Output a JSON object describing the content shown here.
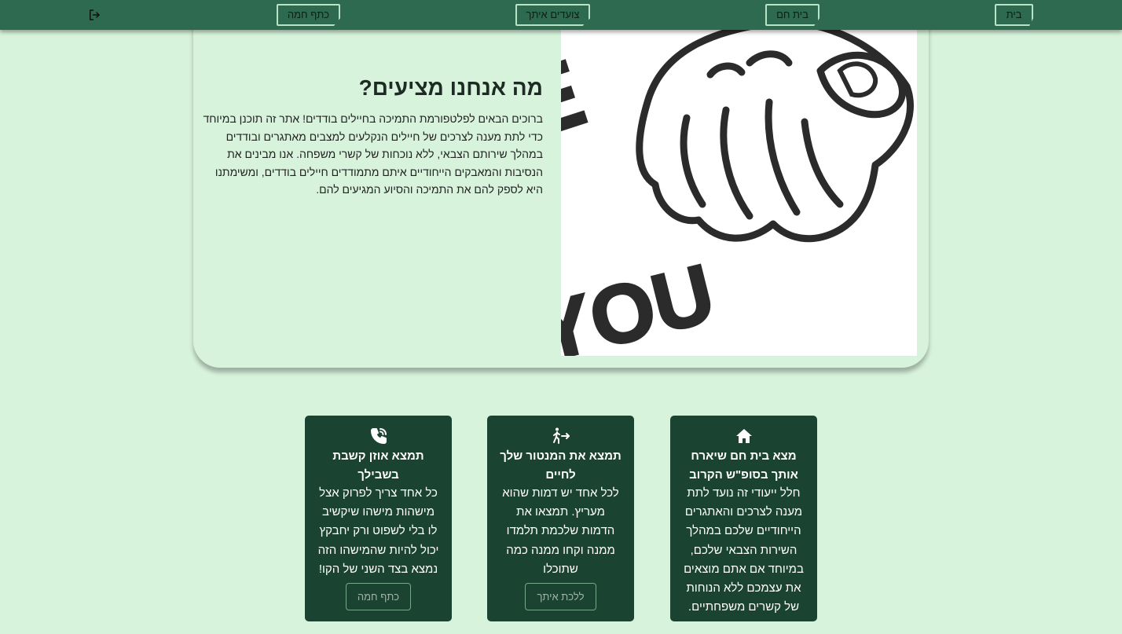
{
  "nav": {
    "items": [
      {
        "label": "בית"
      },
      {
        "label": "בית חם"
      },
      {
        "label": "צועדים איתך"
      },
      {
        "label": "כתף חמה"
      }
    ]
  },
  "hero": {
    "title": "מה אנחנו מציעים?",
    "body": "ברוכים הבאים לפלטפורמת התמיכה בחיילים בודדים! אתר זה תוכנן במיוחד כדי לתת מענה לצרכים של חיילים הנקלעים למצבים מאתגרים ובודדים במהלך שירותם הצבאי, ללא נוכחות של קשרי משפחה. אנו מבינים את הנסיבות והמאבקים הייחודיים איתם מתמודדים חיילים בודדים, ומשימתנו היא לספק להם את התמיכה והסיוע המגיעים להם.",
    "image_text_top": "WE",
    "image_text_bottom": "YOU!"
  },
  "cards": [
    {
      "icon": "home-icon",
      "title": "מצא בית חם שיארח אותך בסופ\"ש הקרוב",
      "text": "חלל ייעודי זה נועד לתת מענה לצרכים והאתגרים הייחודיים שלכם במהלך השירות הצבאי שלכם, במיוחד אם אתם מוצאים את עצמכם ללא הנוחות של קשרים משפחתיים. אנו מבינים את",
      "button": ""
    },
    {
      "icon": "walking-person-icon",
      "title": "תמצא את המנטור שלך לחיים",
      "text": "לכל אחד יש דמות שהוא מעריץ. תמצאו את הדמות שלכמת תלמדו ממנה וקחו ממנה כמה שתוכלו",
      "button": "ללכת איתך"
    },
    {
      "icon": "phone-icon",
      "title": "תמצא אוזן קשבת בשבילך",
      "text": "כל אחד צריך לפרוק אצל מישהות מישהו שיקשיב לו בלי לשפוט ורק יחבקץ יכול להיות שהמישהו הזה נמצא בצד השני של הקו!",
      "button": "כתף חמה"
    }
  ],
  "colors": {
    "background": "#d8f3dc",
    "navbar": "#2d6a4f",
    "card": "#1b4332",
    "nav_border": "#b7e4c7"
  }
}
